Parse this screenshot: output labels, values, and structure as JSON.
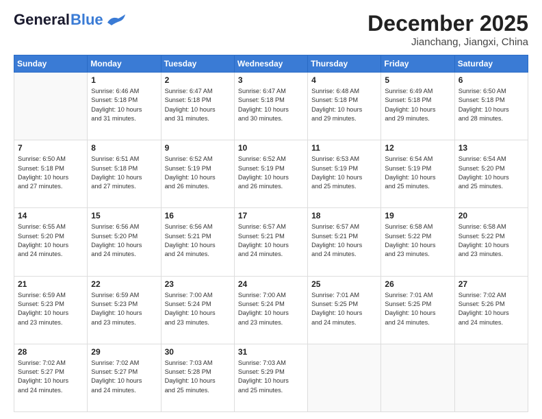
{
  "logo": {
    "general": "General",
    "blue": "Blue"
  },
  "header": {
    "month": "December 2025",
    "location": "Jianchang, Jiangxi, China"
  },
  "weekdays": [
    "Sunday",
    "Monday",
    "Tuesday",
    "Wednesday",
    "Thursday",
    "Friday",
    "Saturday"
  ],
  "weeks": [
    [
      {
        "day": "",
        "info": ""
      },
      {
        "day": "1",
        "info": "Sunrise: 6:46 AM\nSunset: 5:18 PM\nDaylight: 10 hours\nand 31 minutes."
      },
      {
        "day": "2",
        "info": "Sunrise: 6:47 AM\nSunset: 5:18 PM\nDaylight: 10 hours\nand 31 minutes."
      },
      {
        "day": "3",
        "info": "Sunrise: 6:47 AM\nSunset: 5:18 PM\nDaylight: 10 hours\nand 30 minutes."
      },
      {
        "day": "4",
        "info": "Sunrise: 6:48 AM\nSunset: 5:18 PM\nDaylight: 10 hours\nand 29 minutes."
      },
      {
        "day": "5",
        "info": "Sunrise: 6:49 AM\nSunset: 5:18 PM\nDaylight: 10 hours\nand 29 minutes."
      },
      {
        "day": "6",
        "info": "Sunrise: 6:50 AM\nSunset: 5:18 PM\nDaylight: 10 hours\nand 28 minutes."
      }
    ],
    [
      {
        "day": "7",
        "info": "Sunrise: 6:50 AM\nSunset: 5:18 PM\nDaylight: 10 hours\nand 27 minutes."
      },
      {
        "day": "8",
        "info": "Sunrise: 6:51 AM\nSunset: 5:18 PM\nDaylight: 10 hours\nand 27 minutes."
      },
      {
        "day": "9",
        "info": "Sunrise: 6:52 AM\nSunset: 5:19 PM\nDaylight: 10 hours\nand 26 minutes."
      },
      {
        "day": "10",
        "info": "Sunrise: 6:52 AM\nSunset: 5:19 PM\nDaylight: 10 hours\nand 26 minutes."
      },
      {
        "day": "11",
        "info": "Sunrise: 6:53 AM\nSunset: 5:19 PM\nDaylight: 10 hours\nand 25 minutes."
      },
      {
        "day": "12",
        "info": "Sunrise: 6:54 AM\nSunset: 5:19 PM\nDaylight: 10 hours\nand 25 minutes."
      },
      {
        "day": "13",
        "info": "Sunrise: 6:54 AM\nSunset: 5:20 PM\nDaylight: 10 hours\nand 25 minutes."
      }
    ],
    [
      {
        "day": "14",
        "info": "Sunrise: 6:55 AM\nSunset: 5:20 PM\nDaylight: 10 hours\nand 24 minutes."
      },
      {
        "day": "15",
        "info": "Sunrise: 6:56 AM\nSunset: 5:20 PM\nDaylight: 10 hours\nand 24 minutes."
      },
      {
        "day": "16",
        "info": "Sunrise: 6:56 AM\nSunset: 5:21 PM\nDaylight: 10 hours\nand 24 minutes."
      },
      {
        "day": "17",
        "info": "Sunrise: 6:57 AM\nSunset: 5:21 PM\nDaylight: 10 hours\nand 24 minutes."
      },
      {
        "day": "18",
        "info": "Sunrise: 6:57 AM\nSunset: 5:21 PM\nDaylight: 10 hours\nand 24 minutes."
      },
      {
        "day": "19",
        "info": "Sunrise: 6:58 AM\nSunset: 5:22 PM\nDaylight: 10 hours\nand 23 minutes."
      },
      {
        "day": "20",
        "info": "Sunrise: 6:58 AM\nSunset: 5:22 PM\nDaylight: 10 hours\nand 23 minutes."
      }
    ],
    [
      {
        "day": "21",
        "info": "Sunrise: 6:59 AM\nSunset: 5:23 PM\nDaylight: 10 hours\nand 23 minutes."
      },
      {
        "day": "22",
        "info": "Sunrise: 6:59 AM\nSunset: 5:23 PM\nDaylight: 10 hours\nand 23 minutes."
      },
      {
        "day": "23",
        "info": "Sunrise: 7:00 AM\nSunset: 5:24 PM\nDaylight: 10 hours\nand 23 minutes."
      },
      {
        "day": "24",
        "info": "Sunrise: 7:00 AM\nSunset: 5:24 PM\nDaylight: 10 hours\nand 23 minutes."
      },
      {
        "day": "25",
        "info": "Sunrise: 7:01 AM\nSunset: 5:25 PM\nDaylight: 10 hours\nand 24 minutes."
      },
      {
        "day": "26",
        "info": "Sunrise: 7:01 AM\nSunset: 5:25 PM\nDaylight: 10 hours\nand 24 minutes."
      },
      {
        "day": "27",
        "info": "Sunrise: 7:02 AM\nSunset: 5:26 PM\nDaylight: 10 hours\nand 24 minutes."
      }
    ],
    [
      {
        "day": "28",
        "info": "Sunrise: 7:02 AM\nSunset: 5:27 PM\nDaylight: 10 hours\nand 24 minutes."
      },
      {
        "day": "29",
        "info": "Sunrise: 7:02 AM\nSunset: 5:27 PM\nDaylight: 10 hours\nand 24 minutes."
      },
      {
        "day": "30",
        "info": "Sunrise: 7:03 AM\nSunset: 5:28 PM\nDaylight: 10 hours\nand 25 minutes."
      },
      {
        "day": "31",
        "info": "Sunrise: 7:03 AM\nSunset: 5:29 PM\nDaylight: 10 hours\nand 25 minutes."
      },
      {
        "day": "",
        "info": ""
      },
      {
        "day": "",
        "info": ""
      },
      {
        "day": "",
        "info": ""
      }
    ]
  ]
}
